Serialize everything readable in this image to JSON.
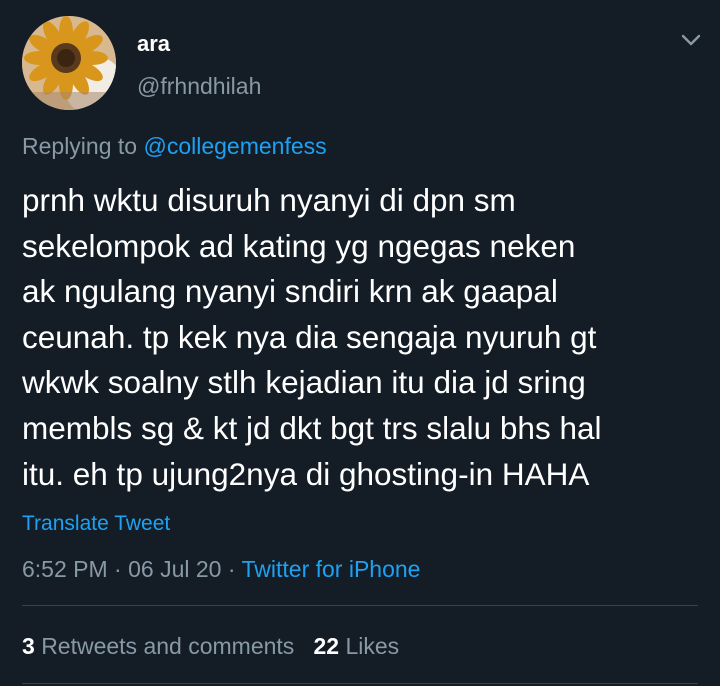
{
  "user": {
    "display_name": "ara",
    "handle": "@frhndhilah"
  },
  "reply": {
    "prefix": "Replying to",
    "mention": "@collegemenfess"
  },
  "tweet": {
    "lines": [
      "prnh wktu disuruh nyanyi di dpn sm",
      "sekelompok ad kating yg ngegas neken",
      "ak ngulang nyanyi sndiri krn ak gaapal",
      "ceunah. tp kek nya dia sengaja nyuruh gt",
      "wkwk soalny stlh kejadian itu dia jd sring",
      "membls sg & kt jd dkt bgt trs slalu bhs hal",
      "itu. eh tp ujung2nya di ghosting-in HAHA"
    ]
  },
  "translate_label": "Translate Tweet",
  "meta": {
    "time": "6:52 PM",
    "date": "06 Jul 20",
    "source": "Twitter for iPhone"
  },
  "stats": {
    "retweets_count": "3",
    "retweets_label": "Retweets and comments",
    "likes_count": "22",
    "likes_label": "Likes"
  },
  "icons": {
    "menu": "chevron-down-icon",
    "avatar": "sunflower-avatar"
  },
  "colors": {
    "background": "#141d26",
    "accent": "#1da1f2",
    "secondary_text": "#8899a6",
    "divider": "#38444d"
  }
}
